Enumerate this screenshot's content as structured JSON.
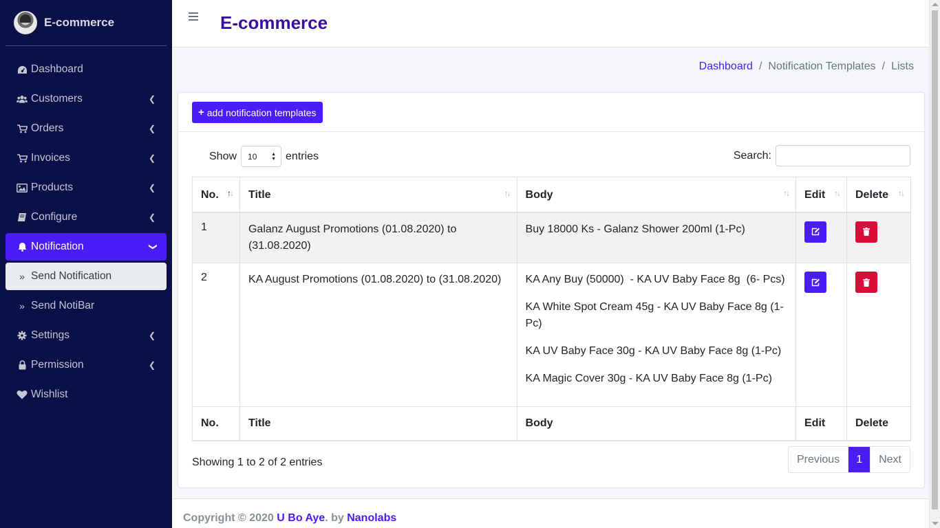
{
  "app": {
    "brand": "E-commerce",
    "title": "E-commerce"
  },
  "sidebar": {
    "items": [
      {
        "label": "Dashboard",
        "icon": "dashboard-icon"
      },
      {
        "label": "Customers",
        "icon": "users-icon"
      },
      {
        "label": "Orders",
        "icon": "cart-icon"
      },
      {
        "label": "Invoices",
        "icon": "cart-icon"
      },
      {
        "label": "Products",
        "icon": "image-icon"
      },
      {
        "label": "Configure",
        "icon": "book-icon"
      },
      {
        "label": "Notification",
        "icon": "bell-icon"
      },
      {
        "label": "Send Notification",
        "icon": "double-chevron-icon"
      },
      {
        "label": "Send NotiBar",
        "icon": "double-chevron-icon"
      },
      {
        "label": "Settings",
        "icon": "gear-icon"
      },
      {
        "label": "Permission",
        "icon": "lock-icon"
      },
      {
        "label": "Wishlist",
        "icon": "heart-icon"
      }
    ]
  },
  "breadcrumb": {
    "home": "Dashboard",
    "section": "Notification Templates",
    "current": "Lists"
  },
  "toolbar": {
    "add_label": "add notification templates"
  },
  "table_controls": {
    "show_label": "Show",
    "page_length": "10",
    "entries_label": "entries",
    "search_label": "Search:",
    "search_value": ""
  },
  "table": {
    "columns": [
      "No.",
      "Title",
      "Body",
      "Edit",
      "Delete"
    ],
    "rows": [
      {
        "no": "1",
        "title": "Galanz August Promotions (01.08.2020) to (31.08.2020)",
        "body": [
          "Buy 18000 Ks - Galanz Shower 200ml (1-Pc)"
        ]
      },
      {
        "no": "2",
        "title": "KA August Promotions (01.08.2020) to (31.08.2020)",
        "body": [
          "KA Any Buy (50000)  - KA UV Baby Face 8g  (6- Pcs)",
          "KA White Spot Cream 45g - KA UV Baby Face 8g (1-Pc)",
          "KA UV Baby Face 30g - KA UV Baby Face 8g (1-Pc)",
          "KA Magic Cover 30g - KA UV Baby Face 8g (1-Pc)"
        ]
      }
    ]
  },
  "pagination": {
    "info": "Showing 1 to 2 of 2 entries",
    "previous": "Previous",
    "current": "1",
    "next": "Next"
  },
  "footer": {
    "prefix": "Copyright © 2020 ",
    "author": "U Bo Aye",
    "middle": ". by ",
    "company": "Nanolabs"
  },
  "colors": {
    "sidebar_bg": "#0c1049",
    "accent": "#4c1cf8",
    "danger": "#dc0c3a",
    "title": "#3a0fa0"
  }
}
